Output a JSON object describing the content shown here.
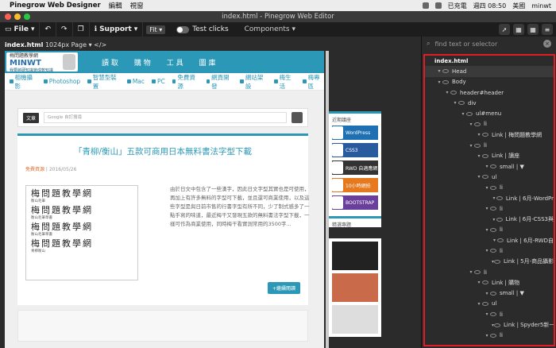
{
  "menubar": {
    "app_name": "Pinegrow Web Designer",
    "menus": [
      "編輯",
      "視窗"
    ],
    "battery": "已充電",
    "clock": "週四 08:50",
    "lang": "美國",
    "user": "minwt"
  },
  "window": {
    "title": "index.html - Pinegrow Web Editor"
  },
  "toolbar": {
    "file": "File",
    "support": "Support",
    "fit": "Fit",
    "test_clicks": "Test clicks",
    "components": "Components"
  },
  "page_info": {
    "file": "index.html",
    "size": "1024px",
    "page": "Page"
  },
  "site": {
    "logo_top": "梅問題教學網",
    "logo": "MINWT",
    "logo_sub": "我要將硬知識變成軟知識",
    "nav": [
      "讀 取",
      "購 物",
      "工 具",
      "圖 庫"
    ],
    "subnav": [
      "相機攝影",
      "Photoshop",
      "智慧型裝置",
      "Mac",
      "PC",
      "免費資源",
      "網頁開發",
      "網站架設",
      "梅生活",
      "梅專區"
    ],
    "search_select": "文章",
    "search_placeholder": "Google 自訂搜尋",
    "article_title": "「青柳/衡山」五款可商用日本無料書法字型下載",
    "meta_cat": "免費資源",
    "meta_date": "2016/05/26",
    "callig": [
      {
        "text": "梅問題教學網",
        "label": "衡山毛筆"
      },
      {
        "text": "梅問題教學網",
        "label": "衡山毛筆草書"
      },
      {
        "text": "梅問題教學網",
        "label": "衡山毛筆草書"
      },
      {
        "text": "梅問題教學網",
        "label": "青柳衡山"
      }
    ],
    "body": "由於日文中包含了一些漢字，因此日文字型其實也是可使用，再加上有許多無料的字型可下載，並且還可商業使用，以及這些字型是與日前市售的行書字型有所不同，少了制式感多了一點手寫的味道，最近梅干又發現五款的無料書法字型下載，一樣可作為商業使用，同時梅干看實測常用的3500字...",
    "more": "+繼續閱讀",
    "side_title": "近期議座",
    "ads": [
      "WordPress",
      "CSS3",
      "RWD 自適應網",
      "10小時網拍",
      "BOOTSTRAP"
    ],
    "side2": "精選專題"
  },
  "tree": {
    "search_placeholder": "find text or selector",
    "rows": [
      {
        "t": "index.html"
      },
      {
        "t": "Head"
      },
      {
        "t": "Body"
      },
      {
        "t": "header#header"
      },
      {
        "t": "div"
      },
      {
        "t": "ul#menu"
      },
      {
        "t": "li"
      },
      {
        "t": "Link | 梅問題教學網"
      },
      {
        "t": "li"
      },
      {
        "t": "Link | 讀座"
      },
      {
        "t": "small | ▼"
      },
      {
        "t": "ul"
      },
      {
        "t": "li"
      },
      {
        "t": "Link | 6月-WordPr"
      },
      {
        "t": "li"
      },
      {
        "t": "Link | 6月-CSS3與"
      },
      {
        "t": "li"
      },
      {
        "t": "Link | 6月-RWD自"
      },
      {
        "t": "li"
      },
      {
        "t": "Link | 5月-商品攝影"
      },
      {
        "t": "li"
      },
      {
        "t": "Link | 購物"
      },
      {
        "t": "small | ▼"
      },
      {
        "t": "ul"
      },
      {
        "t": "li"
      },
      {
        "t": "Link | Spyder5新一"
      },
      {
        "t": "li"
      }
    ]
  }
}
